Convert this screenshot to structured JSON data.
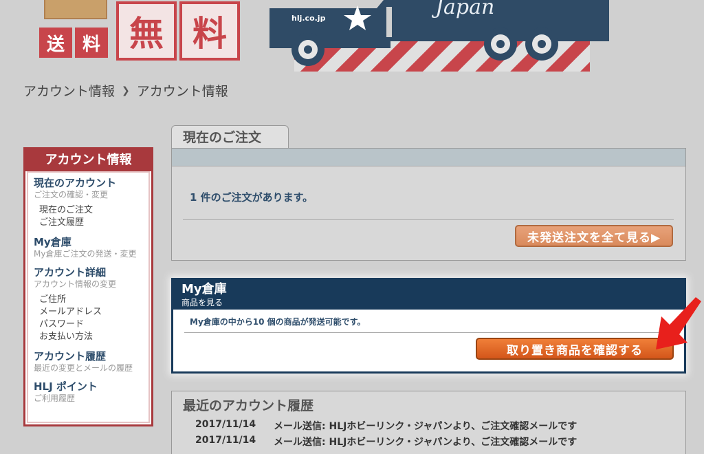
{
  "banner": {
    "stamp_chars": [
      "送",
      "料",
      "無",
      "料"
    ],
    "truck_domain": "hlj.co.jp",
    "truck_script": "Japan",
    "colors": {
      "stamp_red": "#c8454b",
      "truck_blue": "#2f4b66"
    }
  },
  "breadcrumb": {
    "items": [
      "アカウント情報",
      "アカウント情報"
    ],
    "separator": "❯"
  },
  "sidebar": {
    "title": "アカウント情報",
    "sections": [
      {
        "title": "現在のアカウント",
        "subtitle": "ご注文の確認・変更",
        "links": [
          "現在のご注文",
          "ご注文履歴"
        ]
      },
      {
        "title": "My倉庫",
        "subtitle": "My倉庫ご注文の発送・変更",
        "links": []
      },
      {
        "title": "アカウント詳細",
        "subtitle": "アカウント情報の変更",
        "links": [
          "ご住所",
          "メールアドレス",
          "パスワード",
          "お支払い方法"
        ]
      },
      {
        "title": "アカウント履歴",
        "subtitle": "最近の変更とメールの履歴",
        "links": []
      },
      {
        "title": "HLJ ポイント",
        "subtitle": "ご利用履歴",
        "links": []
      }
    ]
  },
  "current_orders": {
    "tab_label": "現在のご注文",
    "message": "1 件のご注文があります。",
    "button_label": "未発送注文を全て見る▶"
  },
  "warehouse": {
    "title": "My倉庫",
    "subtitle": "商品を見る",
    "message": "My倉庫の中から10 個の商品が発送可能です。",
    "button_label": "取り置き商品を確認する"
  },
  "history": {
    "title": "最近のアカウント履歴",
    "rows": [
      {
        "date": "2017/11/14",
        "text": "メール送信: HLJホビーリンク・ジャパンより、ご注文確認メールです"
      },
      {
        "date": "2017/11/14",
        "text": "メール送信: HLJホビーリンク・ジャパンより、ご注文確認メールです"
      }
    ]
  }
}
